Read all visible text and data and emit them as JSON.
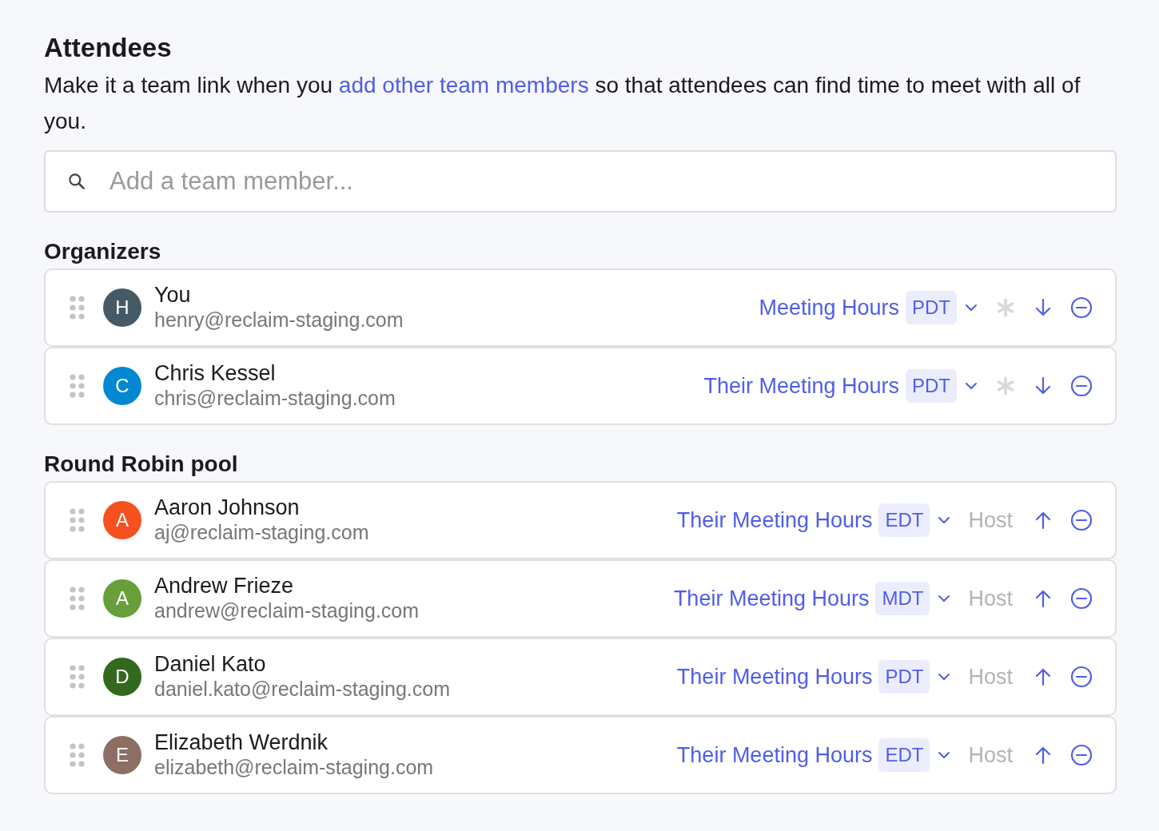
{
  "title": "Attendees",
  "description": {
    "before": "Make it a team link when you ",
    "link": "add other team members",
    "after": " so that attendees can find time to meet with all of you."
  },
  "search": {
    "placeholder": "Add a team member..."
  },
  "sections": [
    {
      "title": "Organizers",
      "kind": "organizers",
      "members": [
        {
          "initial": "H",
          "color": "#455a64",
          "name": "You",
          "email": "henry@reclaim-staging.com",
          "hours": "Meeting Hours",
          "timezone": "PDT"
        },
        {
          "initial": "C",
          "color": "#0288d1",
          "name": "Chris Kessel",
          "email": "chris@reclaim-staging.com",
          "hours": "Their Meeting Hours",
          "timezone": "PDT"
        }
      ]
    },
    {
      "title": "Round Robin pool",
      "kind": "pool",
      "members": [
        {
          "initial": "A",
          "color": "#f4511e",
          "name": "Aaron Johnson",
          "email": "aj@reclaim-staging.com",
          "hours": "Their Meeting Hours",
          "timezone": "EDT",
          "host": "Host"
        },
        {
          "initial": "A",
          "color": "#689f38",
          "name": "Andrew Frieze",
          "email": "andrew@reclaim-staging.com",
          "hours": "Their Meeting Hours",
          "timezone": "MDT",
          "host": "Host"
        },
        {
          "initial": "D",
          "color": "#33691e",
          "name": "Daniel Kato",
          "email": "daniel.kato@reclaim-staging.com",
          "hours": "Their Meeting Hours",
          "timezone": "PDT",
          "host": "Host"
        },
        {
          "initial": "E",
          "color": "#8d6e63",
          "name": "Elizabeth Werdnik",
          "email": "elizabeth@reclaim-staging.com",
          "hours": "Their Meeting Hours",
          "timezone": "EDT",
          "host": "Host"
        }
      ]
    }
  ]
}
